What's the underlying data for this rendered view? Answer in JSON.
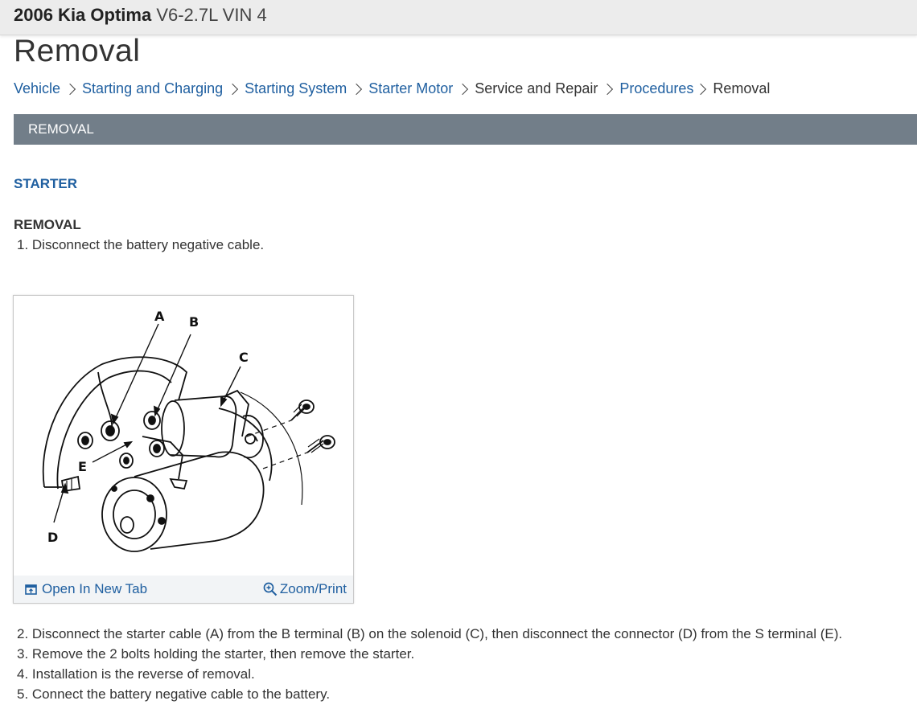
{
  "header": {
    "make_model": "2006 Kia Optima",
    "engine": "V6-2.7L VIN 4"
  },
  "page_title": "Removal",
  "breadcrumb": [
    "Vehicle",
    "Starting and Charging",
    "Starting System",
    "Starter Motor",
    "Service and Repair",
    "Procedures",
    "Removal"
  ],
  "section_bar": "REMOVAL",
  "sub_heading": "STARTER",
  "step_heading": "REMOVAL",
  "steps": [
    "1. Disconnect the battery negative cable.",
    "2. Disconnect the starter cable (A) from the B terminal (B) on the solenoid (C), then disconnect the connector (D) from the S terminal (E).",
    "3. Remove the 2 bolts holding the starter, then remove the starter.",
    "4. Installation is the reverse of removal.",
    "5. Connect the battery negative cable to the battery."
  ],
  "figure": {
    "labels": [
      "A",
      "B",
      "C",
      "D",
      "E"
    ],
    "open_new_tab": "Open In New Tab",
    "zoom_print": "Zoom/Print",
    "open_icon": "open-new-tab-icon",
    "zoom_icon": "zoom-icon"
  },
  "colors": {
    "link": "#1f5fa0",
    "section_bar": "#727e89",
    "top_bar": "#ececec"
  }
}
